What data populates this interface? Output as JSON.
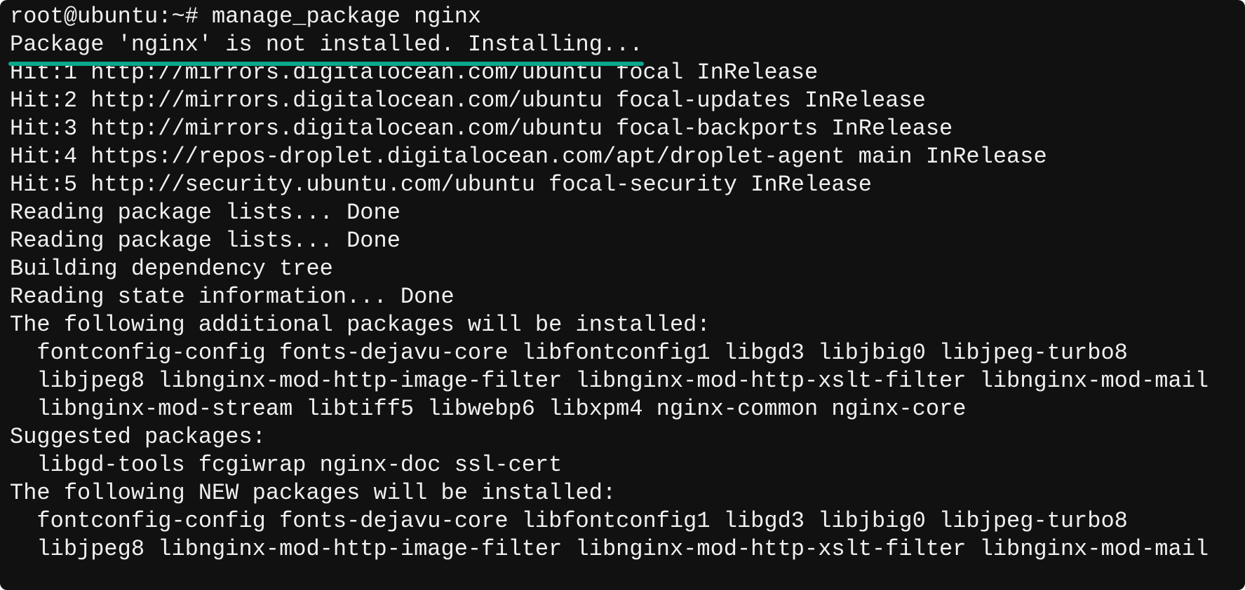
{
  "terminal": {
    "highlight_color": "#0aa88c",
    "highlighted_line_index": 1,
    "lines": [
      "root@ubuntu:~# manage_package nginx",
      "Package 'nginx' is not installed. Installing...",
      "Hit:1 http://mirrors.digitalocean.com/ubuntu focal InRelease",
      "Hit:2 http://mirrors.digitalocean.com/ubuntu focal-updates InRelease",
      "Hit:3 http://mirrors.digitalocean.com/ubuntu focal-backports InRelease",
      "Hit:4 https://repos-droplet.digitalocean.com/apt/droplet-agent main InRelease",
      "Hit:5 http://security.ubuntu.com/ubuntu focal-security InRelease",
      "Reading package lists... Done",
      "Reading package lists... Done",
      "Building dependency tree",
      "Reading state information... Done",
      "The following additional packages will be installed:",
      "  fontconfig-config fonts-dejavu-core libfontconfig1 libgd3 libjbig0 libjpeg-turbo8",
      "  libjpeg8 libnginx-mod-http-image-filter libnginx-mod-http-xslt-filter libnginx-mod-mail",
      "  libnginx-mod-stream libtiff5 libwebp6 libxpm4 nginx-common nginx-core",
      "Suggested packages:",
      "  libgd-tools fcgiwrap nginx-doc ssl-cert",
      "The following NEW packages will be installed:",
      "  fontconfig-config fonts-dejavu-core libfontconfig1 libgd3 libjbig0 libjpeg-turbo8",
      "  libjpeg8 libnginx-mod-http-image-filter libnginx-mod-http-xslt-filter libnginx-mod-mail"
    ]
  }
}
